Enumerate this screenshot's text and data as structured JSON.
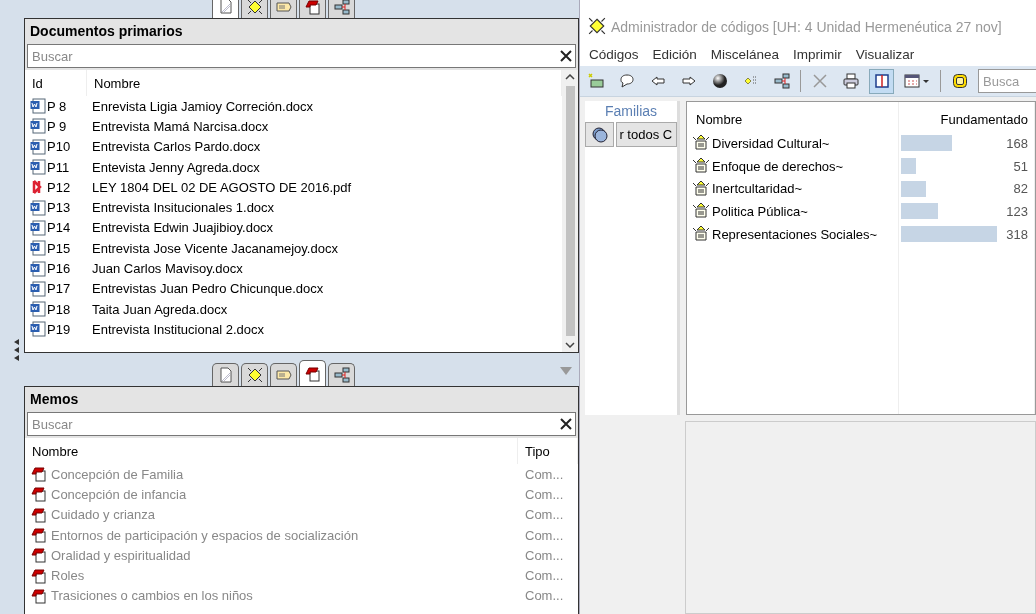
{
  "top_tabs": [
    {
      "kind": "document",
      "selected": true
    },
    {
      "kind": "code",
      "selected": false
    },
    {
      "kind": "quotation",
      "selected": false
    },
    {
      "kind": "memo",
      "selected": false
    },
    {
      "kind": "network",
      "selected": false
    }
  ],
  "documents": {
    "title": "Documentos primarios",
    "search": {
      "placeholder": "Buscar"
    },
    "columns": [
      "Id",
      "Nombre"
    ],
    "rows": [
      {
        "kind": "docx",
        "id": "P 8",
        "name": "Enrevista Ligia Jamioy Correción.docx"
      },
      {
        "kind": "docx",
        "id": "P 9",
        "name": "Entrevista Mamá Narcisa.docx"
      },
      {
        "kind": "docx",
        "id": "P10",
        "name": "Entrevista Carlos Pardo.docx"
      },
      {
        "kind": "docx",
        "id": "P11",
        "name": "Entevista Jenny Agreda.docx"
      },
      {
        "kind": "pdf",
        "id": "P12",
        "name": "LEY 1804 DEL 02 DE AGOSTO DE 2016.pdf"
      },
      {
        "kind": "docx",
        "id": "P13",
        "name": "Entrevista Insitucionales 1.docx"
      },
      {
        "kind": "docx",
        "id": "P14",
        "name": "Entrevista Edwin Juajibioy.docx"
      },
      {
        "kind": "docx",
        "id": "P15",
        "name": "Entrevista Jose Vicente Jacanamejoy.docx"
      },
      {
        "kind": "docx",
        "id": "P16",
        "name": "Juan Carlos Mavisoy.docx"
      },
      {
        "kind": "docx",
        "id": "P17",
        "name": "Entrevistas Juan Pedro Chicunque.docx"
      },
      {
        "kind": "docx",
        "id": "P18",
        "name": "Taita Juan Agreda.docx"
      },
      {
        "kind": "docx",
        "id": "P19",
        "name": "Entrevista Institucional 2.docx"
      }
    ]
  },
  "middle_tabs": [
    {
      "kind": "document",
      "selected": false
    },
    {
      "kind": "code",
      "selected": false
    },
    {
      "kind": "quotation",
      "selected": false
    },
    {
      "kind": "memo",
      "selected": true
    },
    {
      "kind": "network",
      "selected": false
    }
  ],
  "memos": {
    "title": "Memos",
    "search": {
      "placeholder": "Buscar"
    },
    "columns": [
      "Nombre",
      "Tipo"
    ],
    "rows": [
      {
        "name": "Concepción de Familia",
        "type": "Com..."
      },
      {
        "name": "Concepción de infancia",
        "type": "Com..."
      },
      {
        "name": "Cuidado y crianza",
        "type": "Com..."
      },
      {
        "name": "Entornos de participación y espacios de socialización",
        "type": "Com..."
      },
      {
        "name": "Oralidad y espiritualidad",
        "type": "Com..."
      },
      {
        "name": "Roles",
        "type": "Com..."
      },
      {
        "name": "Trasiciones o cambios en los niños",
        "type": "Com..."
      }
    ]
  },
  "code_manager": {
    "title": "Administrador de códigos [UH: 4 Unidad Hermenéutica 27 nov]",
    "menu": [
      "Códigos",
      "Edición",
      "Miscelánea",
      "Imprimir",
      "Visualizar"
    ],
    "toolbar": [
      {
        "kind": "new",
        "selected": false
      },
      {
        "kind": "comment",
        "selected": false
      },
      {
        "kind": "back",
        "selected": false
      },
      {
        "kind": "forward",
        "selected": false
      },
      {
        "kind": "sphere",
        "selected": false
      },
      {
        "kind": "codelist",
        "selected": false
      },
      {
        "kind": "network",
        "selected": false
      },
      {
        "kind": "separator"
      },
      {
        "kind": "delete",
        "selected": false
      },
      {
        "kind": "print",
        "selected": false
      },
      {
        "kind": "split",
        "selected": true
      },
      {
        "kind": "grid",
        "selected": false
      },
      {
        "kind": "separator"
      },
      {
        "kind": "filter",
        "selected": false
      }
    ],
    "search": {
      "placeholder": "Busca"
    },
    "families": {
      "title": "Familias",
      "filter_label": "r todos C"
    },
    "columns": [
      "Nombre",
      "Fundamentado"
    ],
    "codes": [
      {
        "name": "Diversidad Cultural~",
        "grounded": "168"
      },
      {
        "name": "Enfoque de derechos~",
        "grounded": "51"
      },
      {
        "name": "Inertcultaridad~",
        "grounded": "82"
      },
      {
        "name": "Politica Pública~",
        "grounded": "123"
      },
      {
        "name": "Representaciones Sociales~",
        "grounded": "318"
      }
    ]
  }
}
